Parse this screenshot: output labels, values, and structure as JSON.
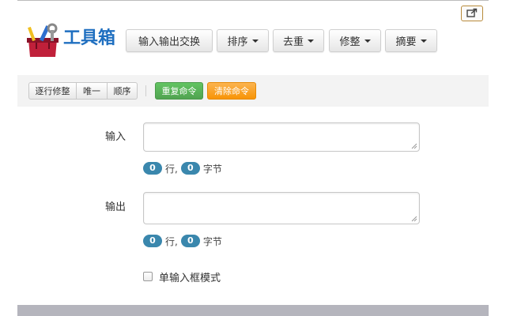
{
  "brand": {
    "name": "工具箱"
  },
  "nav": {
    "swap": "输入输出交换",
    "sort": "排序",
    "dedupe": "去重",
    "trim": "修整",
    "digest": "摘要"
  },
  "toolbar": {
    "line_trim": "逐行修整",
    "unique": "唯一",
    "order": "顺序",
    "repeat": "重复命令",
    "clear": "清除命令"
  },
  "input": {
    "label": "输入",
    "value": "",
    "lines": "0",
    "lines_unit": "行,",
    "bytes": "0",
    "bytes_unit": "字节"
  },
  "output": {
    "label": "输出",
    "value": "",
    "lines": "0",
    "lines_unit": "行,",
    "bytes": "0",
    "bytes_unit": "字节"
  },
  "single_mode": {
    "label": "单输入框模式",
    "checked": false
  },
  "icons": {
    "share": "share-icon",
    "logo": "toolbox-logo-icon"
  },
  "colors": {
    "brand": "#1f6fc0",
    "badge": "#3a87ad",
    "success": "#51a351",
    "warning": "#f89406"
  }
}
